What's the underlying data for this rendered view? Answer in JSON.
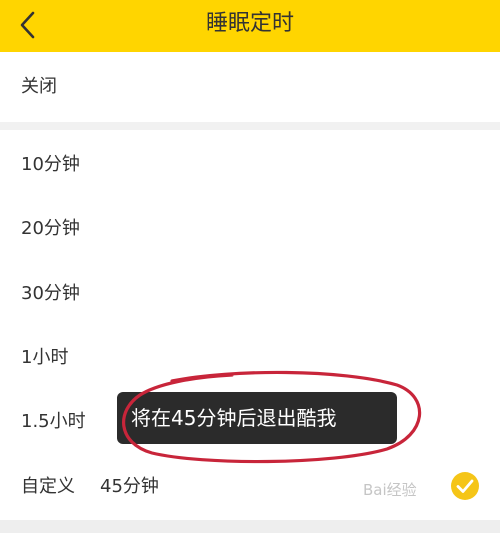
{
  "header": {
    "title": "睡眠定时",
    "back_icon": "chevron-left-icon"
  },
  "options": {
    "off": "关闭",
    "items": [
      "10分钟",
      "20分钟",
      "30分钟",
      "1小时",
      "1.5小时"
    ],
    "custom": {
      "label": "自定义",
      "value": "45分钟",
      "selected": true
    }
  },
  "toast": {
    "text": "将在45分钟后退出酷我"
  },
  "watermark": "Bai经验",
  "colors": {
    "header_bg": "#ffd500",
    "check": "#f5c518",
    "annotation": "#c8253a",
    "toast_bg": "#2b2b2b"
  }
}
